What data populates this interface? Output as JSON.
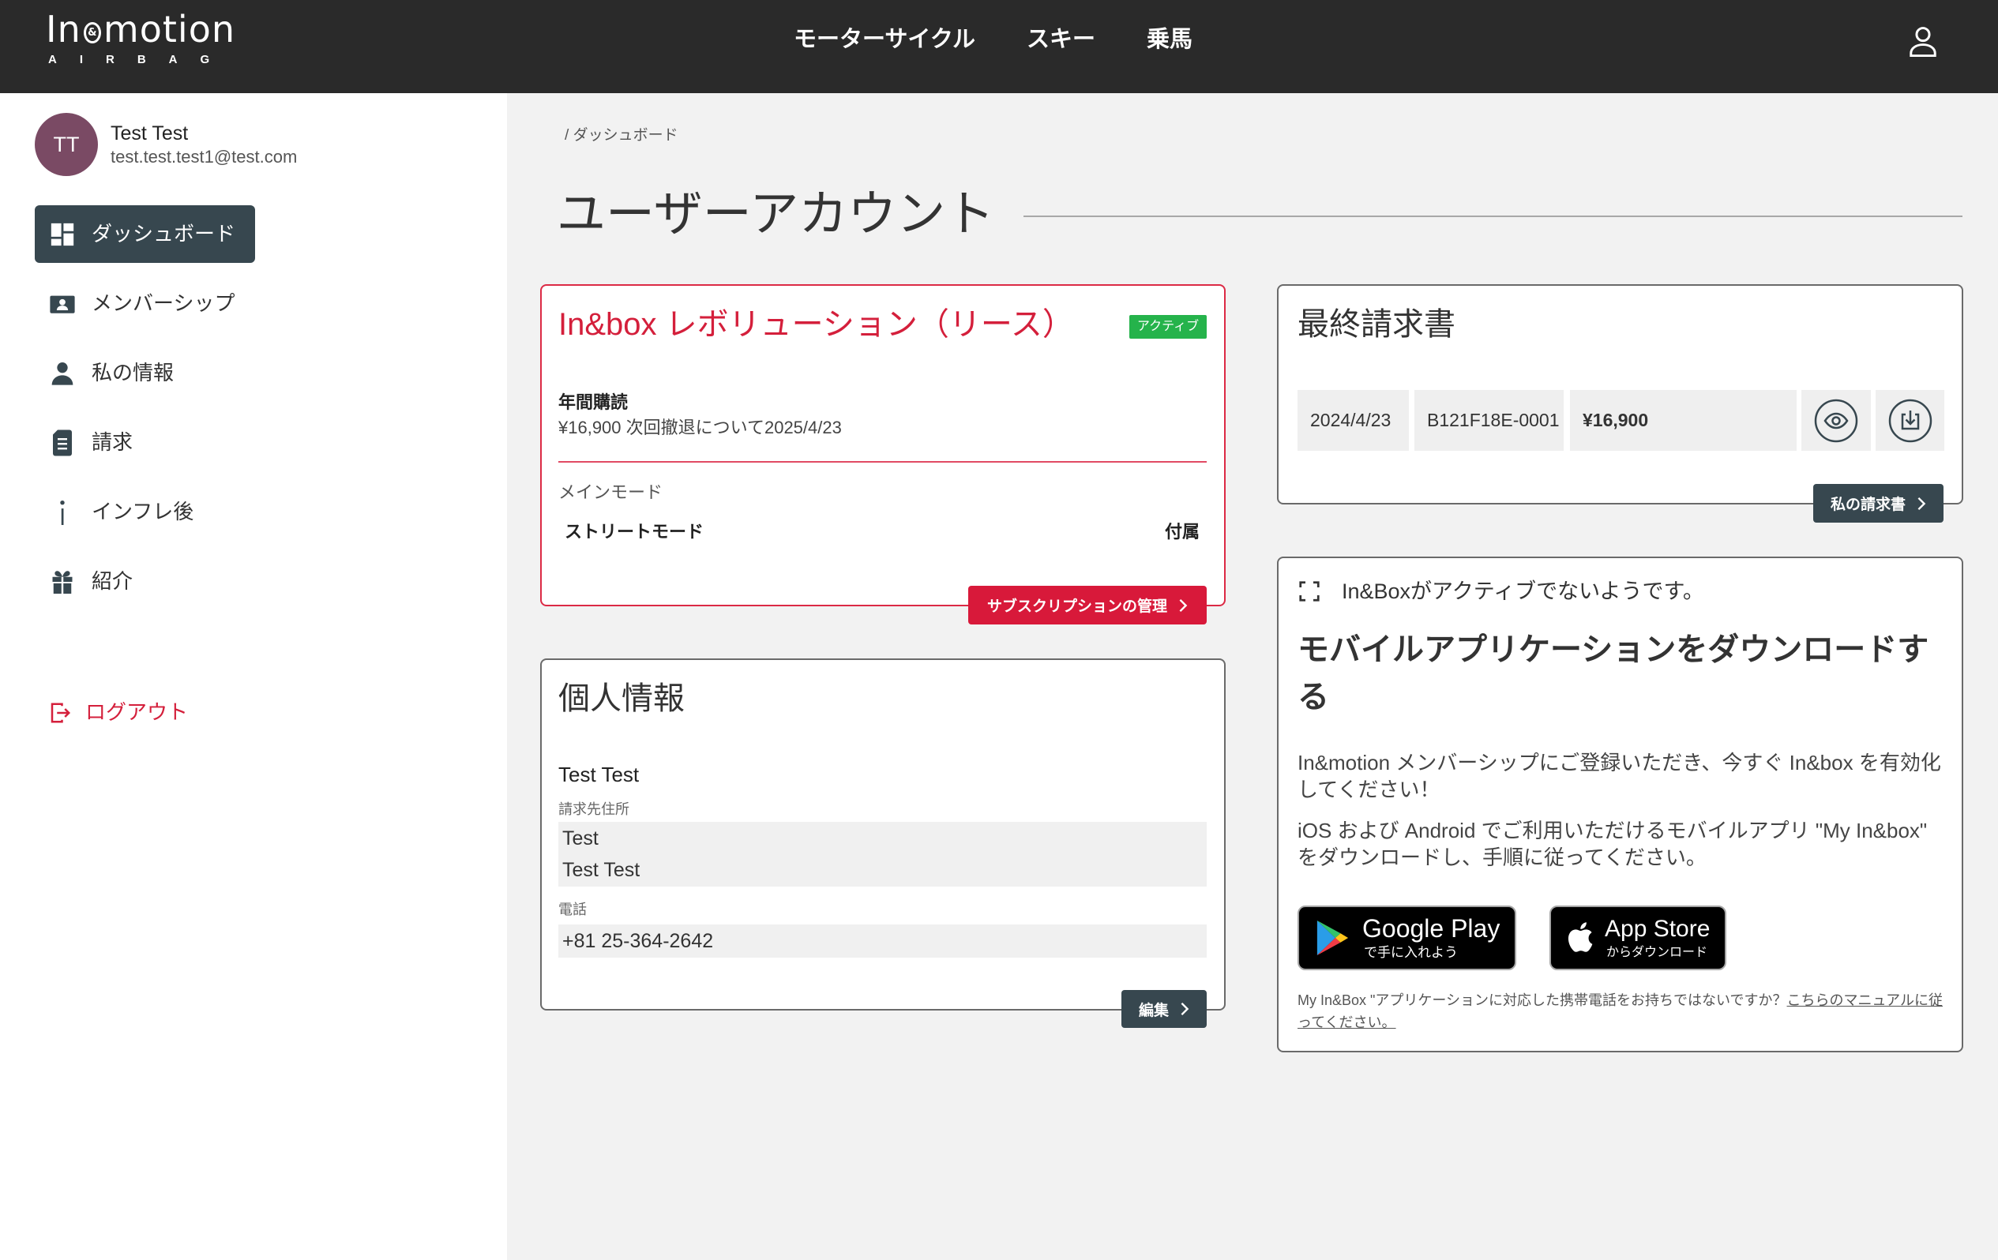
{
  "header": {
    "logo": {
      "left": "In",
      "mark": "&",
      "right": "motion",
      "sub": "AIRBAG"
    },
    "nav": [
      {
        "label": "モーターサイクル"
      },
      {
        "label": "スキー"
      },
      {
        "label": "乗馬"
      }
    ],
    "account_icon": "user-icon"
  },
  "user": {
    "initials": "TT",
    "name": "Test Test",
    "email": "test.test.test1@test.com"
  },
  "sidebar": {
    "items": [
      {
        "label": "ダッシュボード",
        "icon": "dashboard-icon"
      },
      {
        "label": "メンバーシップ",
        "icon": "id-card-icon"
      },
      {
        "label": "私の情報",
        "icon": "person-icon"
      },
      {
        "label": "請求",
        "icon": "billing-document-icon"
      },
      {
        "label": "インフレ後",
        "icon": "info-icon"
      },
      {
        "label": "紹介",
        "icon": "gift-icon"
      }
    ],
    "logout": {
      "label": "ログアウト",
      "icon": "logout-icon"
    }
  },
  "breadcrumb": {
    "separator": "/",
    "current": "ダッシュボード"
  },
  "page_title": "ユーザーアカウント",
  "subscription": {
    "title": "In&box レボリューション（リース）",
    "status": "アクティブ",
    "plan_label": "年間購読",
    "plan_detail": "¥16,900 次回撤退について2025/4/23",
    "mode_label": "メインモード",
    "mode_name": "ストリートモード",
    "mode_status": "付属",
    "manage_button": "サブスクリプションの管理"
  },
  "personal": {
    "title": "個人情報",
    "name": "Test Test",
    "address_label": "請求先住所",
    "address_lines": [
      "Test",
      "Test Test"
    ],
    "phone_label": "電話",
    "phone": "+81 25-364-2642",
    "edit_button": "編集"
  },
  "invoice": {
    "title": "最終請求書",
    "date": "2024/4/23",
    "number": "B121F18E-0001",
    "amount": "¥16,900",
    "view_icon": "eye-icon",
    "download_icon": "download-icon",
    "my_invoices_button": "私の請求書"
  },
  "app": {
    "notice": "In&Boxがアクティブでないようです。",
    "heading": "モバイルアプリケーションをダウンロードする",
    "para1": "In&motion メンバーシップにご登録いただき、今すぐ In&box を有効化してください！",
    "para2": "iOS および Android でご利用いただけるモバイルアプリ \"My In&box\" をダウンロードし、手順に従ってください。",
    "badges": {
      "google_play": {
        "title": "Google Play",
        "subtitle": "で手に入れよう"
      },
      "app_store": {
        "title": "App Store",
        "subtitle": "からダウンロード"
      }
    },
    "footer": {
      "text": "My In&Box \"アプリケーションに対応した携帯電話をお持ちではないですか？",
      "link": "こちらのマニュアルに従ってください。"
    }
  },
  "colors": {
    "header_bg": "#2a2a2a",
    "page_bg": "#f2f2f2",
    "accent_red": "#d8193a",
    "slate": "#37474f",
    "active_green": "#25b34b",
    "avatar": "#7a4a64"
  }
}
